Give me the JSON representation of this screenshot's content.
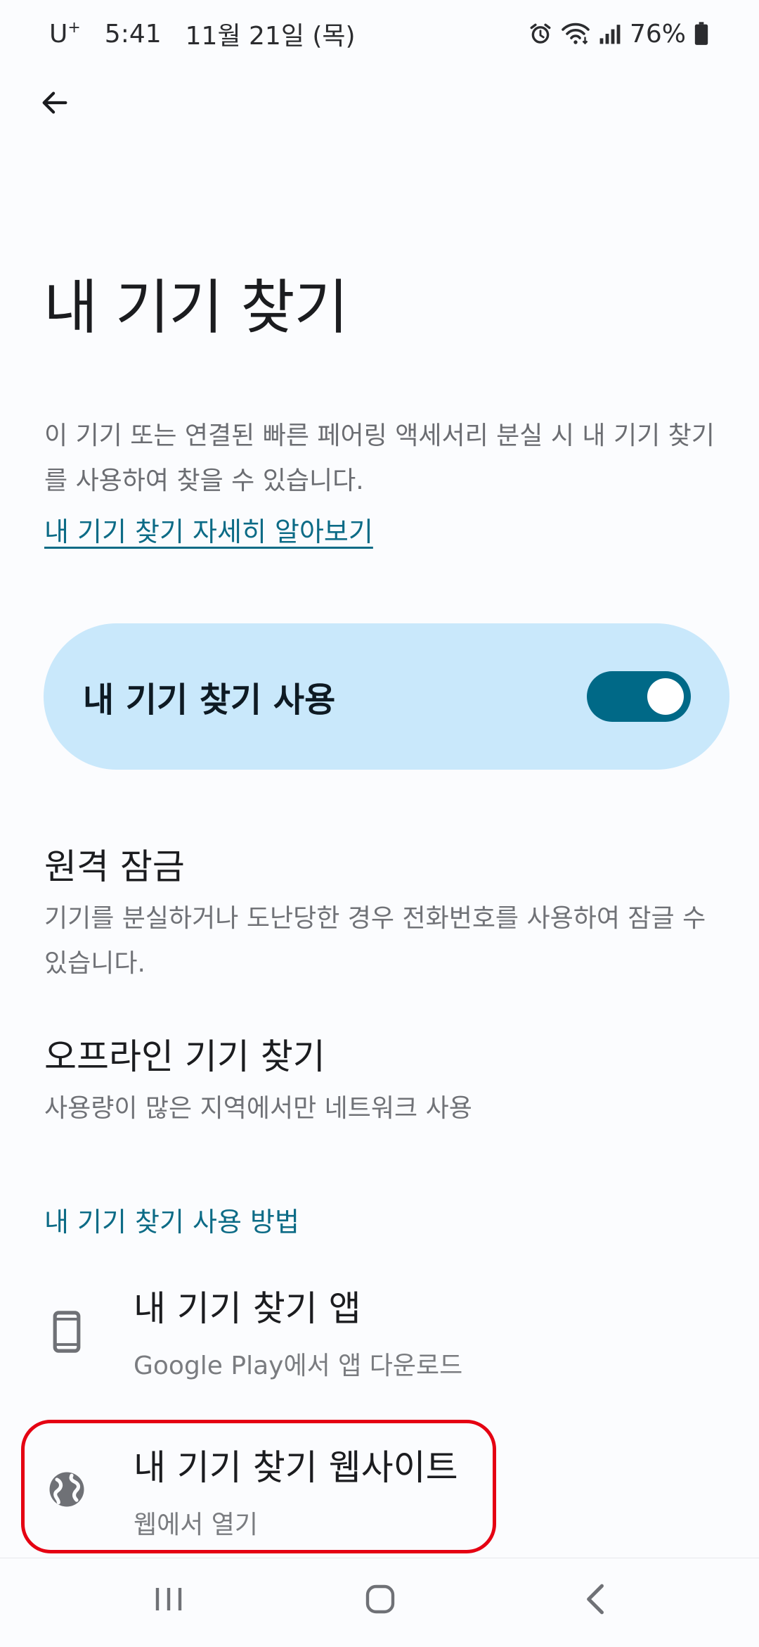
{
  "status_bar": {
    "carrier": "U",
    "carrier_plus": "+",
    "time": "5:41",
    "date": "11월 21일 (목)",
    "battery": "76%",
    "icons": [
      "alarm-icon",
      "wifi-icon",
      "signal-icon",
      "battery-icon"
    ]
  },
  "header": {
    "back_icon": "arrow-left-icon"
  },
  "page": {
    "title": "내 기기 찾기",
    "description": "이 기기 또는 연결된 빠른 페어링 액세서리 분실 시 내 기기 찾기를 사용하여 찾을 수 있습니다.",
    "learn_more": "내 기기 찾기 자세히 알아보기"
  },
  "master_toggle": {
    "label": "내 기기 찾기 사용",
    "enabled": true
  },
  "settings": [
    {
      "title": "원격 잠금",
      "subtitle": "기기를 분실하거나 도난당한 경우 전화번호를 사용하여 잠글 수 있습니다."
    },
    {
      "title": "오프라인 기기 찾기",
      "subtitle": "사용량이 많은 지역에서만 네트워크 사용"
    }
  ],
  "section": {
    "header": "내 기기 찾기 사용 방법",
    "options": [
      {
        "title": "내 기기 찾기 앱",
        "subtitle": "Google Play에서 앱 다운로드",
        "icon": "phone-icon"
      },
      {
        "title": "내 기기 찾기 웹사이트",
        "subtitle": "웹에서 열기",
        "icon": "globe-icon"
      }
    ]
  },
  "colors": {
    "accent": "#0c6b86",
    "toggle_card": "#c9e8fb",
    "switch_on": "#006987",
    "highlight": "#e50012"
  },
  "nav_bar": {
    "icons": [
      "recents-icon",
      "home-icon",
      "back-icon"
    ]
  }
}
